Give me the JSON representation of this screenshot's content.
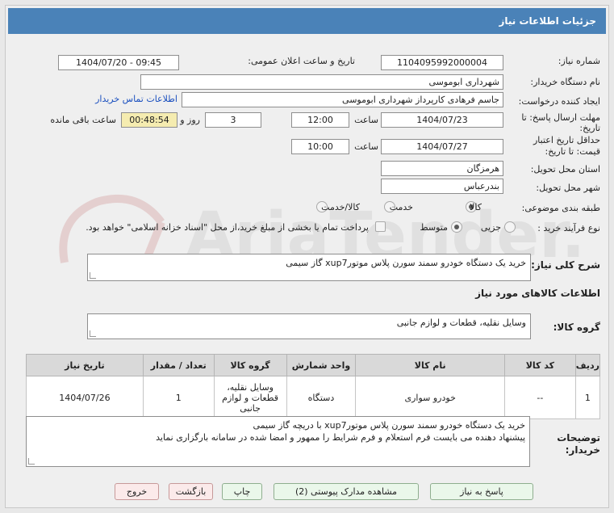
{
  "header": {
    "title": "جزئیات اطلاعات نیاز"
  },
  "fields": {
    "need_number_label": "شماره نیاز:",
    "need_number": "1104095992000004",
    "announce_label": "تاریخ و ساعت اعلان عمومی:",
    "announce_value": "1404/07/20 - 09:45",
    "buyer_label": "نام دستگاه خریدار:",
    "buyer_value": "شهرداری ابوموسی",
    "creator_label": "ایجاد کننده درخواست:",
    "creator_value": "جاسم فرهادی کارپرداز شهرداری ابوموسی",
    "contact_link": "اطلاعات تماس خریدار",
    "deadline_label_1": "مهلت ارسال پاسخ: تا",
    "deadline_label_2": "تاریخ:",
    "deadline_date": "1404/07/23",
    "time_label": "ساعت",
    "deadline_time": "12:00",
    "days_value": "3",
    "days_label": "روز و",
    "remaining_value": "00:48:54",
    "remaining_label": "ساعت باقی مانده",
    "validity_label_1": "حداقل تاریخ اعتبار",
    "validity_label_2": "قیمت: تا تاریخ:",
    "validity_date": "1404/07/27",
    "validity_time": "10:00",
    "province_label": "استان محل تحویل:",
    "province_value": "هرمزگان",
    "city_label": "شهر محل تحویل:",
    "city_value": "بندرعباس",
    "category_label": "طبقه بندی موضوعی:",
    "category_opt1": "کالا",
    "category_opt2": "خدمت",
    "category_opt3": "کالا/خدمت",
    "process_label": "نوع فرآیند خرید :",
    "process_opt1": "جزیی",
    "process_opt2": "متوسط",
    "payment_note": "پرداخت تمام یا بخشی از مبلغ خرید،از محل \"اسناد خزانه اسلامی\" خواهد بود."
  },
  "summary": {
    "label": "شرح کلی نیاز:",
    "value": "خرید یک دستگاه خودرو سمند سورن پلاس موتورxup7 گاز سیمی"
  },
  "goods_info": {
    "title": "اطلاعات کالاهای مورد نیاز",
    "group_label": "گروه کالا:",
    "group_value": "وسایل نقلیه، قطعات و لوازم جانبی"
  },
  "table": {
    "headers": [
      "ردیف",
      "کد کالا",
      "نام کالا",
      "واحد شمارش",
      "گروه کالا",
      "تعداد / مقدار",
      "تاریخ نیاز"
    ],
    "rows": [
      [
        "1",
        "--",
        "خودرو سواری",
        "دستگاه",
        "وسایل نقلیه، قطعات و لوازم جانبی",
        "1",
        "1404/07/26"
      ]
    ]
  },
  "buyer_notes": {
    "label_1": "توضیحات",
    "label_2": "خریدار:",
    "line1": "خرید یک دستگاه خودرو سمند سورن پلاس موتورxup7 با دریچه گاز سیمی",
    "line2": "پیشنهاد دهنده می بایست فرم استعلام و فرم شرایط را ممهور و امضا شده در سامانه بارگزاری نماید"
  },
  "buttons": {
    "reply": "پاسخ به نیاز",
    "attachments": "مشاهده مدارک پیوستی (2)",
    "print": "چاپ",
    "back": "بازگشت",
    "exit": "خروج"
  },
  "watermark": "AriaTender.net",
  "colors": {
    "titlebar": "#4a82b8",
    "link": "#1a4fbf",
    "remaining_bg": "#f5ecb0"
  }
}
